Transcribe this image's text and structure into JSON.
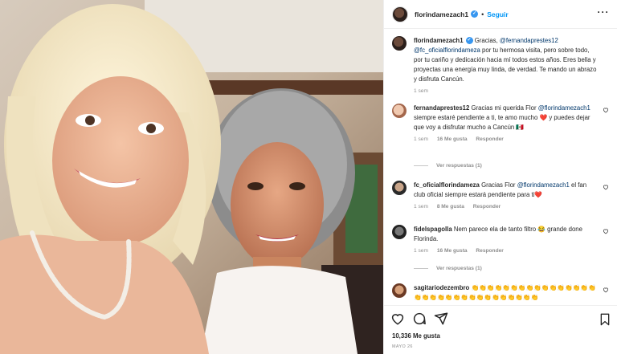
{
  "post_header": {
    "username": "florindamezach1",
    "verified_glyph": "✓",
    "separator": "•",
    "follow_label": "Seguir",
    "more_glyph": "···"
  },
  "caption": {
    "username": "florindamezach1",
    "text_before": "Gracias, ",
    "mention_1": "@fernandaprestes12",
    "mention_2": "@fc_oficialflorindameza",
    "text_after": " por tu hermosa visita, pero sobre todo, por tu cariño y dedicación hacia mí todos estos años. Eres bella y proyectas una energía muy linda, de verdad. Te mando un abrazo y disfruta Cancún.",
    "time": "1 sem"
  },
  "comments": [
    {
      "username": "fernandaprestes12",
      "text_before": "Gracias mi querida Flor ",
      "mention": "@florindamezach1",
      "text_after": " siempre estaré pendiente a ti, te amo mucho ",
      "emoji_1": "❤️",
      "text_after_2": " y puedes dejar que voy a disfrutar mucho a Cancún ",
      "emoji_2": "🇲🇽",
      "time": "1 sem",
      "likes": "16 Me gusta",
      "reply_label": "Responder",
      "replies_label": "Ver respuestas (1)"
    },
    {
      "username": "fc_oficialflorindameza",
      "text_before": "Gracias Flor ",
      "mention": "@florindamezach1",
      "text_after": " el fan club oficial siempre estará pendiente para ti",
      "emoji_1": "❤️",
      "time": "1 sem",
      "likes": "8 Me gusta",
      "reply_label": "Responder"
    },
    {
      "username": "fidelspagolla",
      "text_before": "Nem parece ela de tanto filtro ",
      "emoji_1": "😂",
      "text_after": " grande done Florinda.",
      "time": "1 sem",
      "likes": "16 Me gusta",
      "reply_label": "Responder",
      "replies_label": "Ver respuestas (1)"
    },
    {
      "username": "sagitariodezembro",
      "text_before": "👏👏👏👏👏👏👏👏👏👏👏👏👏👏👏👏👏👏👏👏👏👏👏👏👏👏👏👏👏👏👏👏"
    }
  ],
  "actions": {
    "likes": "10,336 Me gusta",
    "date": "MAYO 26"
  },
  "icons": {
    "like": "heart-icon",
    "comment": "comment-icon",
    "share": "paper-plane-icon",
    "save": "bookmark-icon",
    "comment_like": "small-heart-icon"
  },
  "colors": {
    "link_blue": "#0095f6",
    "mention": "#00376b",
    "meta_gray": "#8e8e8e",
    "heart_red": "#ed4956"
  }
}
